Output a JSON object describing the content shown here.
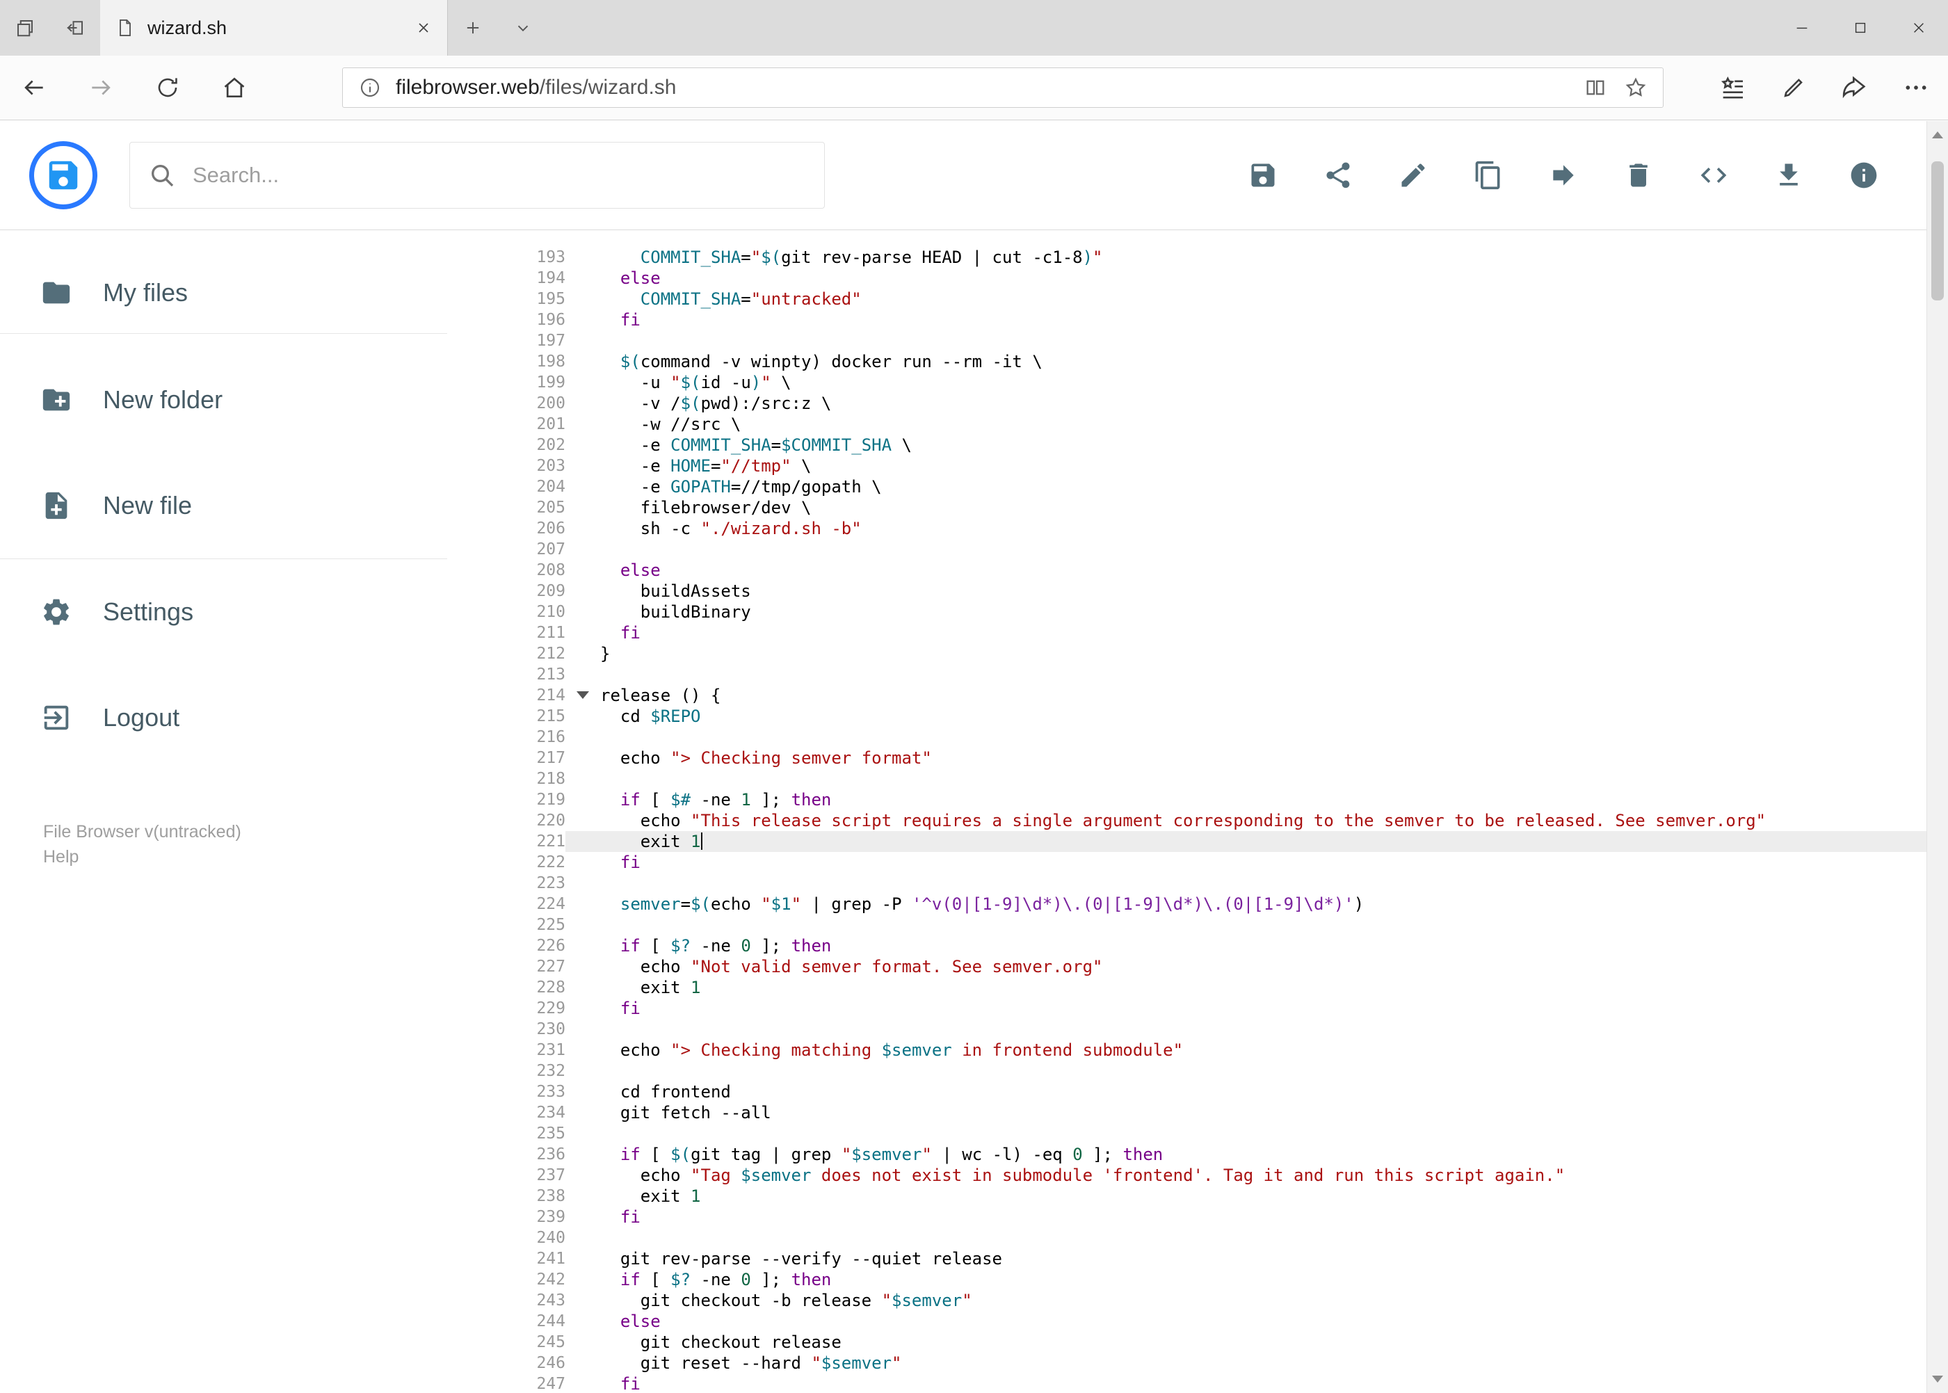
{
  "browser": {
    "tab_title": "wizard.sh",
    "url": {
      "host": "filebrowser.web",
      "path": "/files/wizard.sh"
    }
  },
  "header": {
    "search_placeholder": "Search...",
    "actions": [
      "save-icon",
      "share-icon",
      "edit-icon",
      "copy-icon",
      "move-icon",
      "delete-icon",
      "code-icon",
      "download-icon",
      "info-icon"
    ]
  },
  "sidebar": {
    "items": [
      {
        "label": "My files",
        "icon": "folder-icon"
      },
      {
        "label": "New folder",
        "icon": "new-folder-icon"
      },
      {
        "label": "New file",
        "icon": "new-file-icon"
      },
      {
        "label": "Settings",
        "icon": "settings-icon"
      },
      {
        "label": "Logout",
        "icon": "logout-icon"
      }
    ],
    "footer_version": "File Browser v(untracked)",
    "footer_help": "Help"
  },
  "editor": {
    "language": "shell",
    "active_line": 221,
    "fold_marker_line": 214,
    "lines": [
      {
        "n": 193,
        "text": "    COMMIT_SHA=\"$(git rev-parse HEAD | cut -c1-8)\""
      },
      {
        "n": 194,
        "text": "  else"
      },
      {
        "n": 195,
        "text": "    COMMIT_SHA=\"untracked\""
      },
      {
        "n": 196,
        "text": "  fi"
      },
      {
        "n": 197,
        "text": ""
      },
      {
        "n": 198,
        "text": "  $(command -v winpty) docker run --rm -it \\"
      },
      {
        "n": 199,
        "text": "    -u \"$(id -u)\" \\"
      },
      {
        "n": 200,
        "text": "    -v /$(pwd):/src:z \\"
      },
      {
        "n": 201,
        "text": "    -w //src \\"
      },
      {
        "n": 202,
        "text": "    -e COMMIT_SHA=$COMMIT_SHA \\"
      },
      {
        "n": 203,
        "text": "    -e HOME=\"//tmp\" \\"
      },
      {
        "n": 204,
        "text": "    -e GOPATH=//tmp/gopath \\"
      },
      {
        "n": 205,
        "text": "    filebrowser/dev \\"
      },
      {
        "n": 206,
        "text": "    sh -c \"./wizard.sh -b\""
      },
      {
        "n": 207,
        "text": ""
      },
      {
        "n": 208,
        "text": "  else"
      },
      {
        "n": 209,
        "text": "    buildAssets"
      },
      {
        "n": 210,
        "text": "    buildBinary"
      },
      {
        "n": 211,
        "text": "  fi"
      },
      {
        "n": 212,
        "text": "}"
      },
      {
        "n": 213,
        "text": ""
      },
      {
        "n": 214,
        "text": "release () {"
      },
      {
        "n": 215,
        "text": "  cd $REPO"
      },
      {
        "n": 216,
        "text": ""
      },
      {
        "n": 217,
        "text": "  echo \"> Checking semver format\""
      },
      {
        "n": 218,
        "text": ""
      },
      {
        "n": 219,
        "text": "  if [ $# -ne 1 ]; then"
      },
      {
        "n": 220,
        "text": "    echo \"This release script requires a single argument corresponding to the semver to be released. See semver.org\""
      },
      {
        "n": 221,
        "text": "    exit 1"
      },
      {
        "n": 222,
        "text": "  fi"
      },
      {
        "n": 223,
        "text": ""
      },
      {
        "n": 224,
        "text": "  semver=$(echo \"$1\" | grep -P '^v(0|[1-9]\\d*)\\.(0|[1-9]\\d*)\\.(0|[1-9]\\d*)')"
      },
      {
        "n": 225,
        "text": ""
      },
      {
        "n": 226,
        "text": "  if [ $? -ne 0 ]; then"
      },
      {
        "n": 227,
        "text": "    echo \"Not valid semver format. See semver.org\""
      },
      {
        "n": 228,
        "text": "    exit 1"
      },
      {
        "n": 229,
        "text": "  fi"
      },
      {
        "n": 230,
        "text": ""
      },
      {
        "n": 231,
        "text": "  echo \"> Checking matching $semver in frontend submodule\""
      },
      {
        "n": 232,
        "text": ""
      },
      {
        "n": 233,
        "text": "  cd frontend"
      },
      {
        "n": 234,
        "text": "  git fetch --all"
      },
      {
        "n": 235,
        "text": ""
      },
      {
        "n": 236,
        "text": "  if [ $(git tag | grep \"$semver\" | wc -l) -eq 0 ]; then"
      },
      {
        "n": 237,
        "text": "    echo \"Tag $semver does not exist in submodule 'frontend'. Tag it and run this script again.\""
      },
      {
        "n": 238,
        "text": "    exit 1"
      },
      {
        "n": 239,
        "text": "  fi"
      },
      {
        "n": 240,
        "text": ""
      },
      {
        "n": 241,
        "text": "  git rev-parse --verify --quiet release"
      },
      {
        "n": 242,
        "text": "  if [ $? -ne 0 ]; then"
      },
      {
        "n": 243,
        "text": "    git checkout -b release \"$semver\""
      },
      {
        "n": 244,
        "text": "  else"
      },
      {
        "n": 245,
        "text": "    git checkout release"
      },
      {
        "n": 246,
        "text": "    git reset --hard \"$semver\""
      },
      {
        "n": 247,
        "text": "  fi"
      }
    ]
  },
  "colors": {
    "accent": "#2196f3",
    "logo_ring": "#2979ff",
    "icon_gray": "#546e7a",
    "active_line_bg": "#ededed",
    "syntax": {
      "keyword": "#770088",
      "variable": "#0b7285",
      "string": "#aa1111",
      "string_single": "#7a219e",
      "number": "#116644"
    }
  }
}
